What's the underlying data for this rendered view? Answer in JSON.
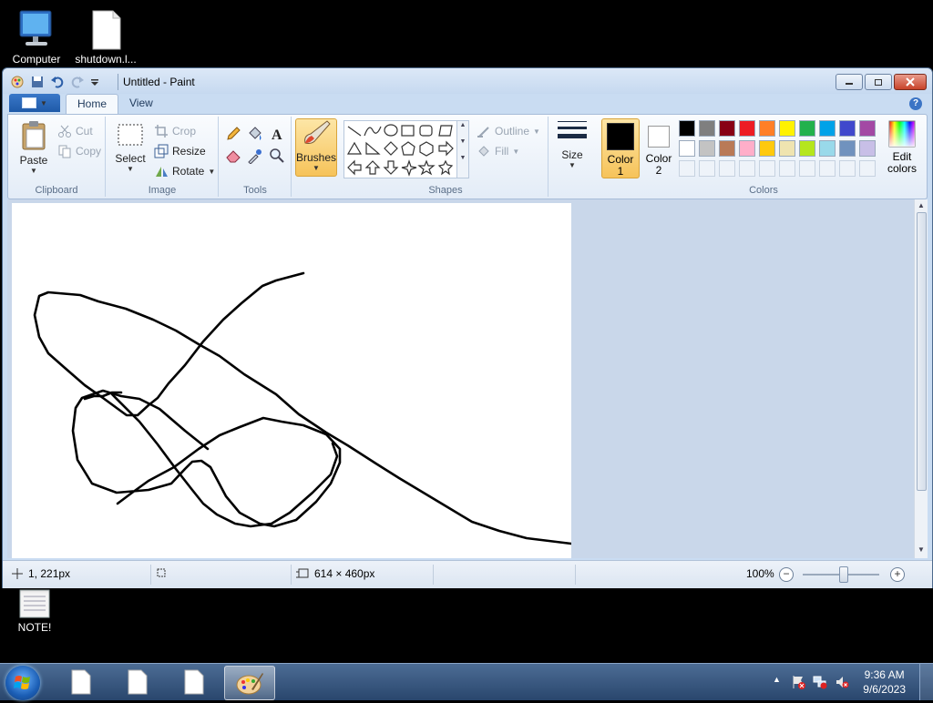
{
  "desktop": {
    "icons": [
      {
        "label": "Computer"
      },
      {
        "label": "shutdown.l..."
      },
      {
        "label": "NOTE!"
      }
    ]
  },
  "window": {
    "title": "Untitled - Paint",
    "tabs": {
      "home": "Home",
      "view": "View"
    }
  },
  "ribbon": {
    "clipboard": {
      "paste": "Paste",
      "cut": "Cut",
      "copy": "Copy",
      "label": "Clipboard"
    },
    "image": {
      "select": "Select",
      "crop": "Crop",
      "resize": "Resize",
      "rotate": "Rotate",
      "label": "Image"
    },
    "tools": {
      "label": "Tools"
    },
    "brushes": {
      "label": "Brushes"
    },
    "shapes": {
      "outline": "Outline",
      "fill": "Fill",
      "label": "Shapes"
    },
    "size": {
      "label": "Size"
    },
    "colors": {
      "color1_label": "Color",
      "color1_num": "1",
      "color2_label": "Color",
      "color2_num": "2",
      "edit": "Edit",
      "edit2": "colors",
      "label": "Colors",
      "color1_value": "#000000",
      "color2_value": "#ffffff",
      "row1": [
        "#000000",
        "#7f7f7f",
        "#880015",
        "#ed1c24",
        "#ff7f27",
        "#fff200",
        "#22b14c",
        "#00a2e8",
        "#3f48cc",
        "#a349a4"
      ],
      "row2": [
        "#ffffff",
        "#c3c3c3",
        "#b97a57",
        "#ffaec9",
        "#ffc90e",
        "#efe4b0",
        "#b5e61d",
        "#99d9ea",
        "#7092be",
        "#c8bfe7"
      ]
    }
  },
  "status": {
    "cursor_pos": "1, 221px",
    "image_size": "614 × 460px",
    "zoom": "100%"
  },
  "taskbar": {
    "time": "9:36 AM",
    "date": "9/6/2023"
  }
}
